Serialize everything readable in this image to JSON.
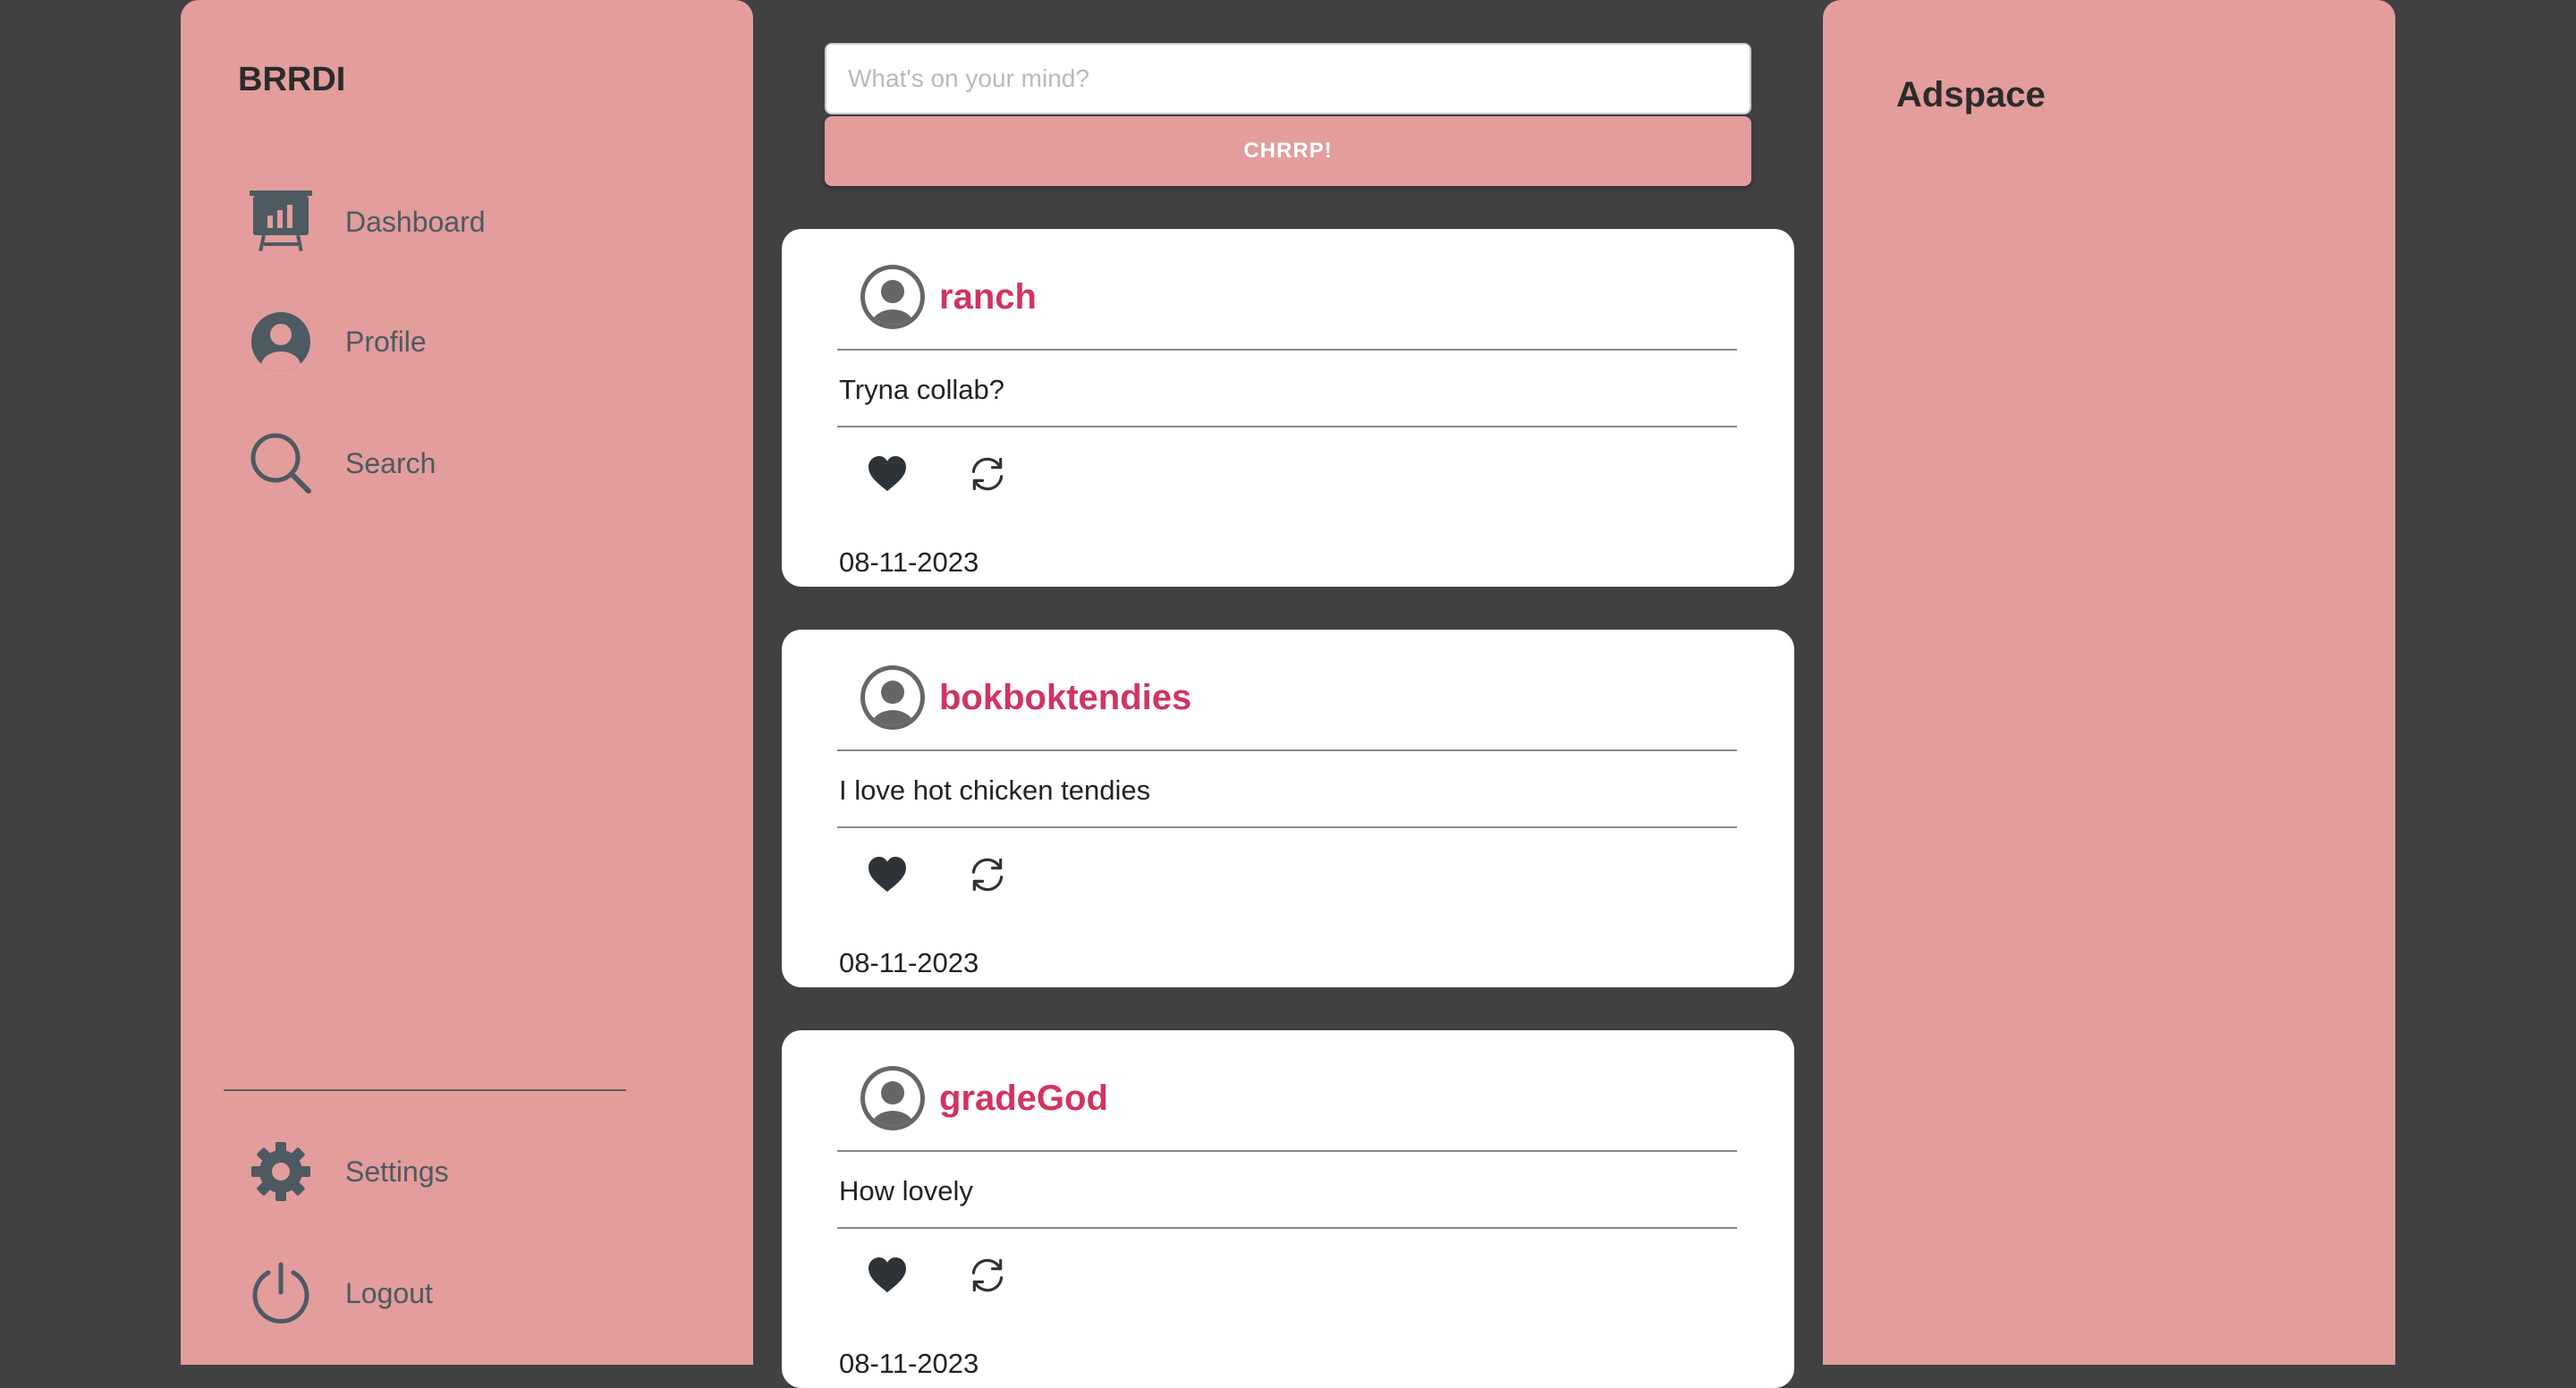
{
  "app": {
    "brand": "BRRDI"
  },
  "sidebar": {
    "items": [
      {
        "label": "Dashboard",
        "icon": "presentation-chart-icon"
      },
      {
        "label": "Profile",
        "icon": "user-circle-icon"
      },
      {
        "label": "Search",
        "icon": "search-icon"
      }
    ],
    "bottom_items": [
      {
        "label": "Settings",
        "icon": "gear-icon"
      },
      {
        "label": "Logout",
        "icon": "power-icon"
      }
    ]
  },
  "composer": {
    "placeholder": "What's on your mind?",
    "value": "",
    "submit_label": "CHRRP!"
  },
  "posts": [
    {
      "username": "ranch",
      "text": "Tryna collab?",
      "date": "08-11-2023"
    },
    {
      "username": "bokboktendies",
      "text": "I love hot chicken tendies",
      "date": "08-11-2023"
    },
    {
      "username": "gradeGod",
      "text": "How lovely",
      "date": "08-11-2023"
    }
  ],
  "adspace": {
    "title": "Adspace"
  },
  "colors": {
    "background": "#414141",
    "panel": "#e29d9c",
    "username": "#d0345f",
    "icon": "#4d5a61",
    "action_icon": "#2e3338"
  }
}
